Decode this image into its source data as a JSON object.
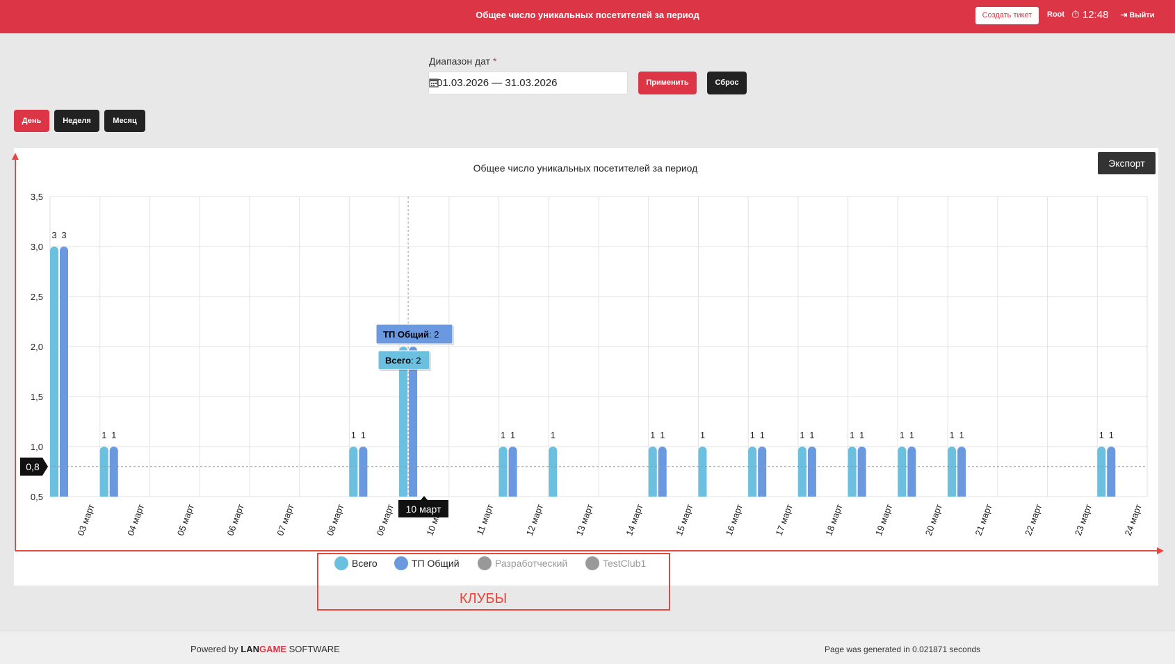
{
  "header": {
    "title": "Общее число уникальных посетителей за период",
    "ticket": "Создать тикет",
    "user": "Root",
    "time": "12:48",
    "logout": "Выйти"
  },
  "filter": {
    "label": "Диапазон дат",
    "required": "*",
    "value": "01.03.2026 — 31.03.2026",
    "apply": "Применить",
    "reset": "Сброс"
  },
  "periods": [
    "День",
    "Неделя",
    "Месяц"
  ],
  "export_label": "Экспорт",
  "colors": {
    "brand": "#dc3545",
    "vsego": "#6bbfdf",
    "tp": "#6b99e0",
    "disabled": "#999999"
  },
  "annotation": "КЛУБЫ",
  "footer": {
    "powered": "Powered by",
    "brand_a": "LAN",
    "brand_b": "GAME",
    "brand_c": "SOFTWARE",
    "gen": "Page was generated in 0.021871 seconds"
  },
  "chart_data": {
    "type": "bar",
    "title": "Общее число уникальных посетителей за период",
    "categories": [
      "03 март",
      "04 март",
      "05 март",
      "06 март",
      "07 март",
      "08 март",
      "09 март",
      "10 март",
      "11 март",
      "12 март",
      "13 март",
      "14 март",
      "15 март",
      "16 март",
      "17 март",
      "18 март",
      "19 март",
      "20 март",
      "21 март",
      "22 март",
      "23 март",
      "24 март"
    ],
    "series": [
      {
        "name": "Всего",
        "values": [
          3,
          1,
          null,
          null,
          null,
          null,
          1,
          2,
          null,
          1,
          1,
          null,
          1,
          1,
          1,
          1,
          1,
          1,
          1,
          null,
          null,
          1
        ]
      },
      {
        "name": "ТП Общий",
        "values": [
          3,
          1,
          null,
          null,
          null,
          null,
          1,
          2,
          null,
          1,
          null,
          null,
          1,
          null,
          1,
          1,
          1,
          1,
          1,
          null,
          null,
          1
        ]
      },
      {
        "name": "Разработческий",
        "values": [],
        "hidden": true
      },
      {
        "name": "TestClub1",
        "values": [],
        "hidden": true
      }
    ],
    "yticks": [
      "0,5",
      "1,0",
      "1,5",
      "2,0",
      "2,5",
      "3,0",
      "3,5"
    ],
    "ylim": [
      0.5,
      3.5
    ],
    "grid": true,
    "legend_position": "bottom",
    "tooltip": {
      "category": "10 март",
      "items": [
        {
          "name": "ТП Общий",
          "value": "2"
        },
        {
          "name": "Всего",
          "value": "2"
        }
      ]
    },
    "crosshair_y": "0,8"
  }
}
